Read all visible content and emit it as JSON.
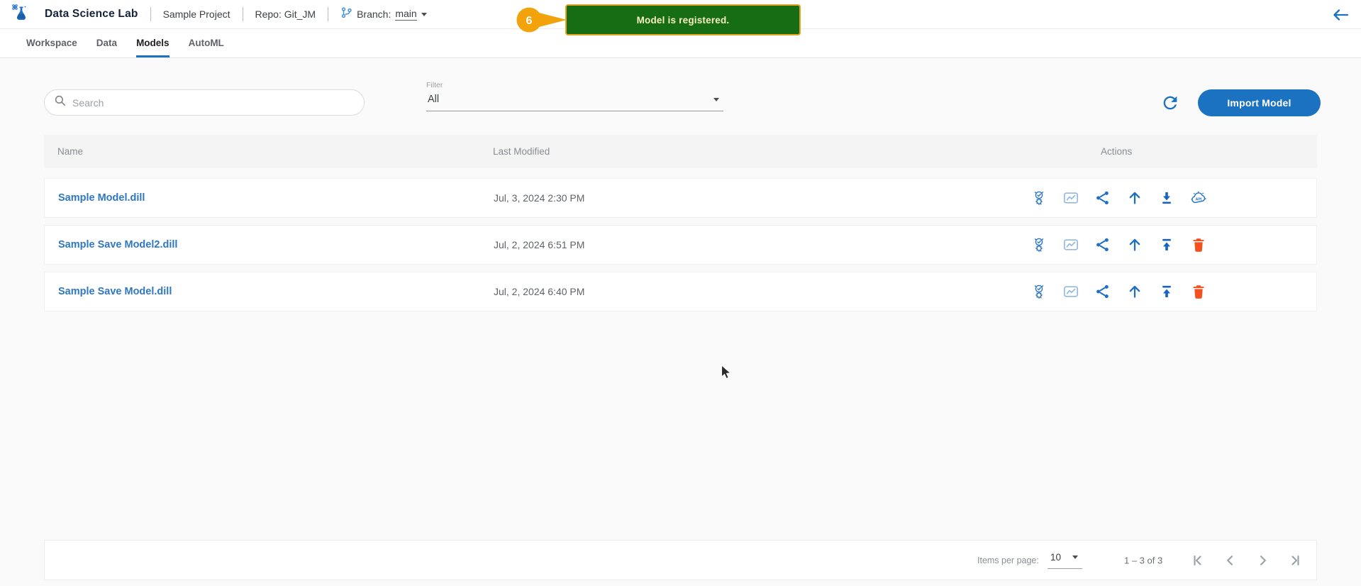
{
  "app": {
    "title": "Data Science Lab",
    "project": "Sample Project",
    "repo": "Repo: Git_JM",
    "branch_label": "Branch:",
    "branch_value": "main"
  },
  "toast": {
    "message": "Model is registered.",
    "badge": "6"
  },
  "tabs": {
    "workspace": "Workspace",
    "data": "Data",
    "models": "Models",
    "automl": "AutoML",
    "active_tab": "Models"
  },
  "controls": {
    "search_placeholder": "Search",
    "filter_label": "Filter",
    "filter_value": "All",
    "import_button": "Import Model"
  },
  "table": {
    "headers": {
      "name": "Name",
      "modified": "Last Modified",
      "actions": "Actions"
    },
    "rows": [
      {
        "name": "Sample Model.dill",
        "modified": "Jul, 3, 2024 2:30 PM",
        "actions": [
          "ml-model",
          "view-plots",
          "share",
          "promote",
          "download",
          "deploy-api"
        ]
      },
      {
        "name": "Sample Save Model2.dill",
        "modified": "Jul, 2, 2024 6:51 PM",
        "actions": [
          "ml-model",
          "view-plots",
          "share",
          "promote",
          "upload",
          "delete"
        ]
      },
      {
        "name": "Sample Save Model.dill",
        "modified": "Jul, 2, 2024 6:40 PM",
        "actions": [
          "ml-model",
          "view-plots",
          "share",
          "promote",
          "upload",
          "delete"
        ]
      }
    ]
  },
  "pagination": {
    "items_per_page_label": "Items per page:",
    "items_per_page_value": "10",
    "range": "1 – 3 of 3"
  },
  "colors": {
    "accent": "#1b72c0",
    "link": "#2e77c2",
    "toast_green": "#176d13",
    "toast_border": "#e9a322",
    "badge_orange": "#f2a20b",
    "delete_red": "#f4511e"
  }
}
